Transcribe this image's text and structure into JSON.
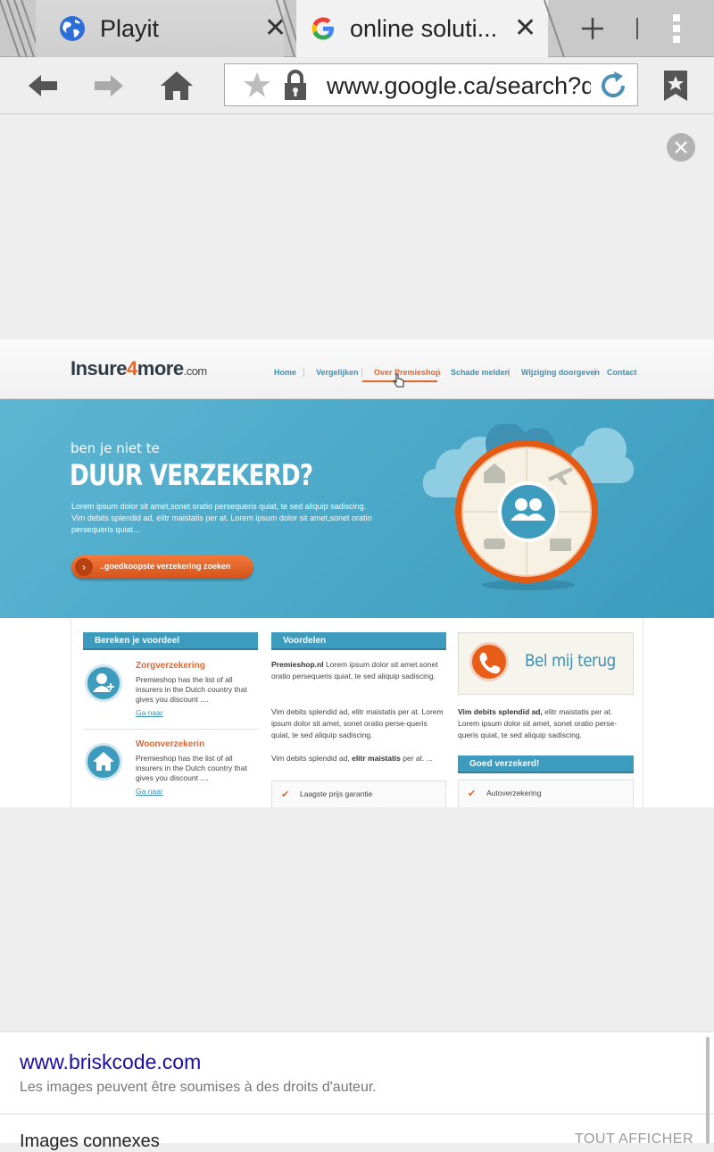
{
  "browser": {
    "tabs": [
      {
        "title": "Playit",
        "close": "✕",
        "active": false
      },
      {
        "title": "online soluti...",
        "close": "✕",
        "active": true
      }
    ],
    "url": "www.google.ca/search?q"
  },
  "website": {
    "logo": {
      "name": "Insure",
      "number": "4",
      "suffix": "more",
      "tld": ".com"
    },
    "nav": [
      "Home",
      "Vergelijken",
      "Over Premieshop",
      "Schade melden",
      "Wijziging doorgeven",
      "Contact"
    ],
    "nav_active_index": 2,
    "hero": {
      "subtitle": "ben je niet te",
      "title": "DUUR VERZEKERD?",
      "body": "Lorem ipsum dolor sit amet,sonet oratio persequeris quiat, te sed aliquip sadiscing. Vim debits splendid ad, elitr maistatis per at. Lorem ipsum dolor sit amet,sonet oratio persequeris quiat...",
      "cta": "..goedkoopste verzekering zoeken",
      "cta_arrow": "›"
    },
    "col1": {
      "heading": "Bereken je voordeel",
      "services": [
        {
          "title": "Zorgverzekering",
          "text": "Premieshop has the list of all insurers in the Dutch country that gives you discount ....",
          "link": "Ga naar"
        },
        {
          "title": "Woonverzekerin",
          "text": "Premieshop has the list of all insurers in the Dutch country that gives you discount ....",
          "link": "Ga naar"
        }
      ]
    },
    "col2": {
      "heading": "Voordelen",
      "p1_bold": "Premieshop.nl",
      "p1": " Lorem ipsum dolor sit amet.sonet oratio persequeris quiat, te sed aliquip sadiscing.",
      "p2": "Vim debits splendid ad, elitr maistatis per at. Lorem ipsum dolor sit amet, sonet oratio perse-queris quiat, te sed aliquip sadiscing.",
      "p3_start": "Vim debits splendid ad, ",
      "p3_bold": "elitr maistatis",
      "p3_end": " per at. ...",
      "check": "Laagste prijs garantie"
    },
    "col3": {
      "callback": "Bel mij terug",
      "p_bold": "Vim debits splendid ad,",
      "p": " elitr maistatis per at. Lorem ipsum dolor sit amet, sonet oratio perse-queris quiat, te sed aliquip sadiscing.",
      "heading": "Goed verzekerd!",
      "check": "Autoverzekering"
    },
    "check_glyph": "✔"
  },
  "sheet": {
    "source_url": "www.briskcode.com",
    "copyright_note": "Les images peuvent être soumises à des droits d'auteur.",
    "related_label": "Images connexes",
    "show_all": "TOUT AFFICHER"
  },
  "colors": {
    "accent_orange": "#e3652c",
    "accent_blue": "#3d9bbe",
    "link": "#1a0dab"
  }
}
